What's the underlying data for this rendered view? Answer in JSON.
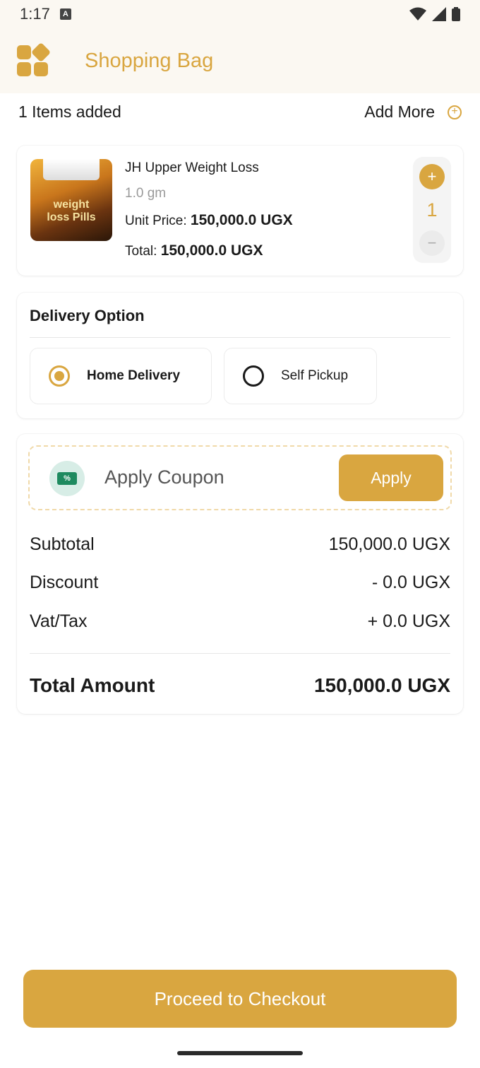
{
  "status_bar": {
    "time": "1:17",
    "notification_badge": "A",
    "icons": [
      "wifi-icon",
      "signal-icon",
      "battery-icon"
    ]
  },
  "app_bar": {
    "title": "Shopping Bag",
    "logo_icon": "grid-logo-icon"
  },
  "cart_header": {
    "items_count_label": "1 Items added",
    "add_more_label": "Add More",
    "add_more_icon": "plus-circle-icon"
  },
  "cart_items": [
    {
      "name": "JH Upper Weight Loss",
      "variant": "1.0 gm",
      "unit_price_label": "Unit Price:",
      "unit_price": "150,000.0 UGX",
      "total_label": "Total:",
      "total": "150,000.0 UGX",
      "quantity": "1",
      "image_text": "weight loss Pills",
      "increment_symbol": "+",
      "decrement_symbol": "−"
    }
  ],
  "delivery": {
    "title": "Delivery Option",
    "options": [
      {
        "label": "Home Delivery",
        "selected": true
      },
      {
        "label": "Self Pickup",
        "selected": false
      }
    ]
  },
  "coupon": {
    "placeholder": "Apply Coupon",
    "apply_label": "Apply",
    "icon": "coupon-ticket-icon",
    "icon_text": "%"
  },
  "summary": {
    "subtotal_label": "Subtotal",
    "subtotal_value": "150,000.0 UGX",
    "discount_label": "Discount",
    "discount_value": "- 0.0 UGX",
    "vat_label": "Vat/Tax",
    "vat_value": "+ 0.0 UGX",
    "total_label": "Total Amount",
    "total_value": "150,000.0 UGX"
  },
  "checkout": {
    "button_label": "Proceed to Checkout"
  },
  "colors": {
    "accent": "#d9a640",
    "header_bg": "#fbf8f2",
    "coupon_icon": "#1e8a5f"
  }
}
